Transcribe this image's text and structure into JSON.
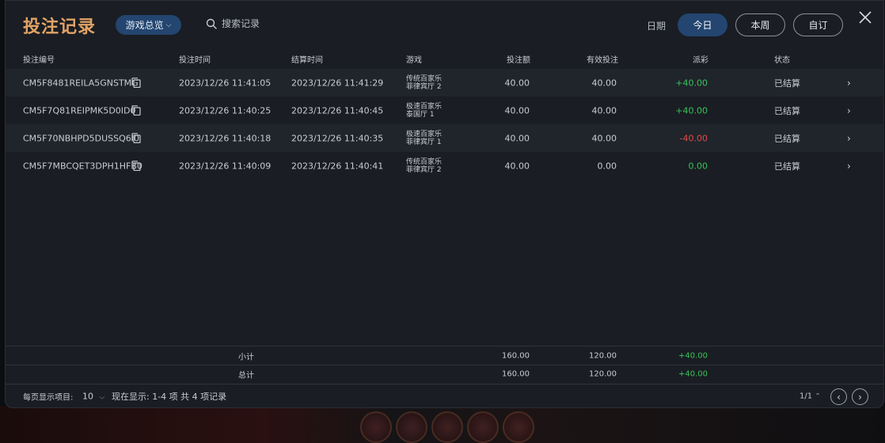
{
  "header": {
    "title": "投注记录",
    "game_filter": "游戏总览",
    "search_label": "搜索记录",
    "date_label": "日期",
    "date_buttons": [
      "今日",
      "本周",
      "自订"
    ],
    "active_date": "今日"
  },
  "columns": [
    "投注编号",
    "投注时间",
    "结算时间",
    "游戏",
    "投注额",
    "有效投注",
    "派彩",
    "状态"
  ],
  "rows": [
    {
      "id": "CM5F8481REILA5GNSTMG",
      "bet_time": "2023/12/26 11:41:05",
      "settle_time": "2023/12/26 11:41:29",
      "game_line1": "传统百家乐",
      "game_line2": "菲律宾厅 2",
      "amount": "40.00",
      "valid": "40.00",
      "payout": "+40.00",
      "payout_kind": "pos",
      "status": "已结算"
    },
    {
      "id": "CM5F7Q81REIPMK5D0ID0",
      "bet_time": "2023/12/26 11:40:25",
      "settle_time": "2023/12/26 11:40:45",
      "game_line1": "极速百家乐",
      "game_line2": "泰国厅 1",
      "amount": "40.00",
      "valid": "40.00",
      "payout": "+40.00",
      "payout_kind": "pos",
      "status": "已结算"
    },
    {
      "id": "CM5F70NBHPD5DUSSQ6I0",
      "bet_time": "2023/12/26 11:40:18",
      "settle_time": "2023/12/26 11:40:35",
      "game_line1": "极速百家乐",
      "game_line2": "菲律宾厅 1",
      "amount": "40.00",
      "valid": "40.00",
      "payout": "-40.00",
      "payout_kind": "neg",
      "status": "已结算"
    },
    {
      "id": "CM5F7MBCQET3DPH1HFB0",
      "bet_time": "2023/12/26 11:40:09",
      "settle_time": "2023/12/26 11:40:41",
      "game_line1": "传统百家乐",
      "game_line2": "菲律宾厅 2",
      "amount": "40.00",
      "valid": "0.00",
      "payout": "0.00",
      "payout_kind": "zero",
      "status": "已结算"
    }
  ],
  "subtotal": {
    "label": "小计",
    "amount": "160.00",
    "valid": "120.00",
    "payout": "+40.00"
  },
  "total": {
    "label": "总计",
    "amount": "160.00",
    "valid": "120.00",
    "payout": "+40.00"
  },
  "footer": {
    "per_page_label": "每页显示项目:",
    "per_page_value": "10",
    "showing_text": "现在显示: 1-4 项 共 4 项记录",
    "page_indicator": "1/1"
  },
  "colors": {
    "accent": "#e0a366",
    "primary": "#23456f",
    "positive": "#37c35a",
    "negative": "#e04b4b"
  }
}
